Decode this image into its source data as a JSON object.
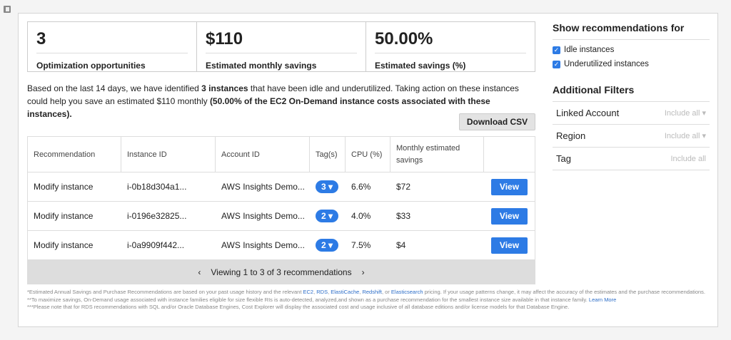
{
  "summary": [
    {
      "value": "3",
      "label": "Optimization opportunities"
    },
    {
      "value": "$110",
      "label": "Estimated monthly savings"
    },
    {
      "value": "50.00%",
      "label": "Estimated savings (%)"
    }
  ],
  "description": {
    "p1": "Based on the last 14 days, we have identified ",
    "count": "3 instances",
    "p2": " that have been idle and underutilized. Taking action on these instances could help you save an estimated $110 monthly ",
    "bold": "(50.00% of the EC2 On-Demand instance costs associated with these instances)."
  },
  "download_label": "Download CSV",
  "table": {
    "headers": [
      "Recommendation",
      "Instance ID",
      "Account ID",
      "Tag(s)",
      "CPU (%)",
      "Monthly estimated savings"
    ],
    "rows": [
      {
        "rec": "Modify instance",
        "id": "i-0b18d304a1...",
        "account": "AWS Insights Demo...",
        "tags": "3",
        "cpu": "6.6%",
        "savings": "$72",
        "action": "View"
      },
      {
        "rec": "Modify instance",
        "id": "i-0196e32825...",
        "account": "AWS Insights Demo...",
        "tags": "2",
        "cpu": "4.0%",
        "savings": "$33",
        "action": "View"
      },
      {
        "rec": "Modify instance",
        "id": "i-0a9909f442...",
        "account": "AWS Insights Demo...",
        "tags": "2",
        "cpu": "7.5%",
        "savings": "$4",
        "action": "View"
      }
    ],
    "pager": "Viewing 1 to 3 of 3 recommendations"
  },
  "notes": {
    "n1a": "*Estimated Annual Savings and Purchase Recommendations are based on your past usage history and the relevant ",
    "ec2": "EC2",
    "rds": "RDS",
    "elasticache": "ElastiCache",
    "redshift": "Redshift",
    "es": "Elasticsearch",
    "n1b": " pricing. If your usage patterns change, it may affect the accuracy of the estimates and the purchase recommendations.",
    "n2": "**To maximize savings, On-Demand usage associated with instance families eligible for size flexible RIs is auto-detected, analyzed,and shown as a purchase recommendation for the smallest instance size available in that instance family. ",
    "learn": "Learn More",
    "n3": "***Please note that for RDS recommendations with SQL and/or Oracle Database Engines, Cost Explorer will display the associated cost and usage inclusive of all database editions and/or license models for that Database Engine."
  },
  "sidebar": {
    "show_title": "Show recommendations for",
    "checks": [
      "Idle instances",
      "Underutilized instances"
    ],
    "filters_title": "Additional Filters",
    "filters": [
      {
        "label": "Linked Account",
        "value": "Include all"
      },
      {
        "label": "Region",
        "value": "Include all"
      },
      {
        "label": "Tag",
        "value": "Include all"
      }
    ]
  }
}
